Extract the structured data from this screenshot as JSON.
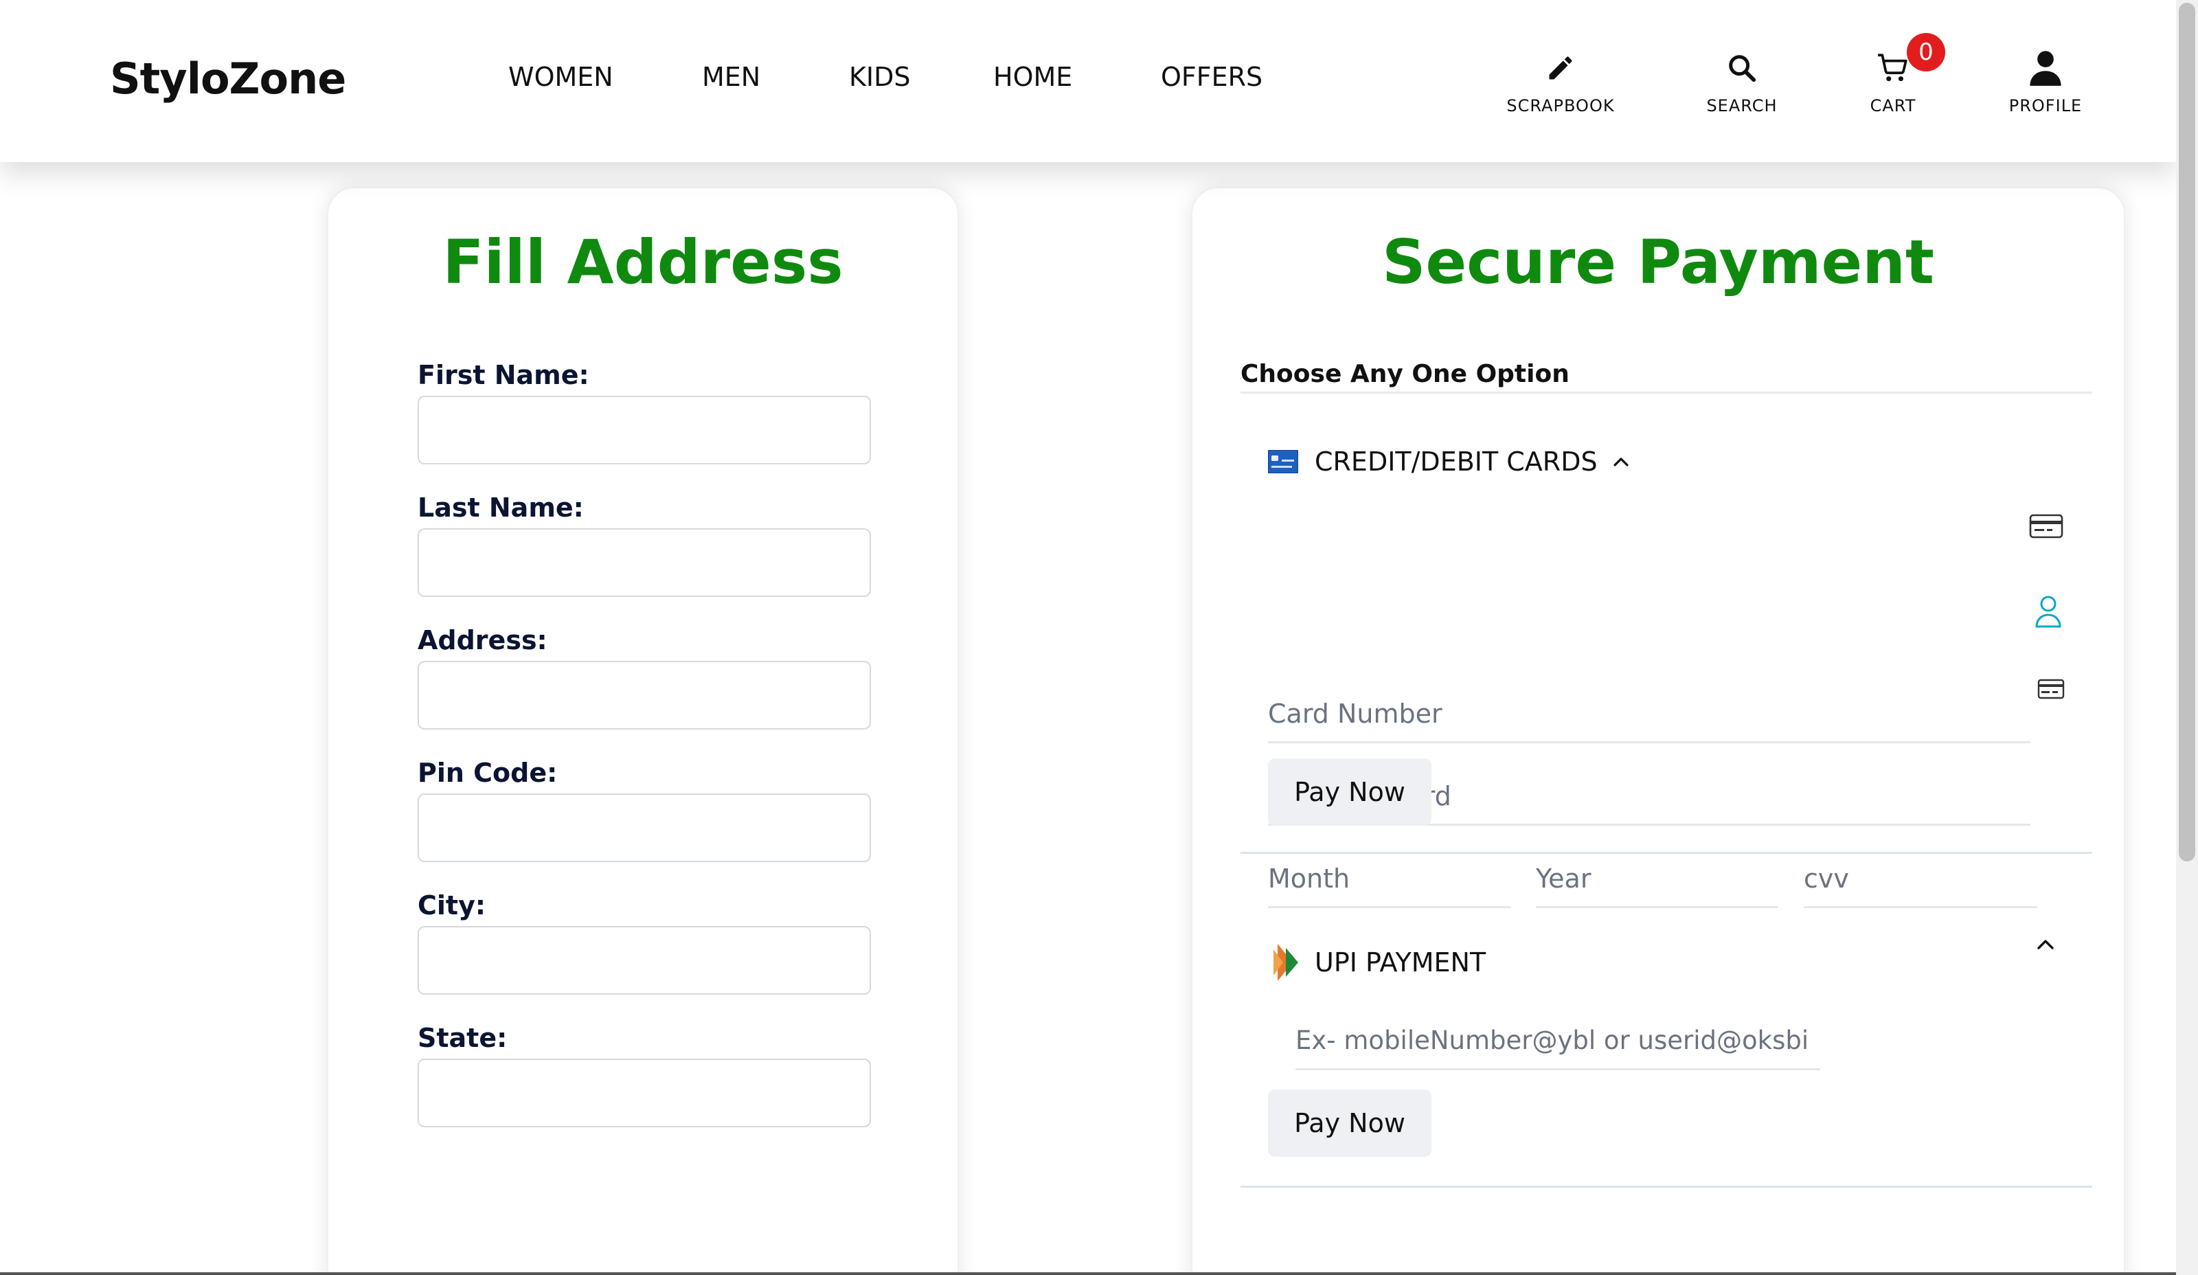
{
  "brand": {
    "logo": "StyloZone"
  },
  "nav": {
    "links": [
      "WOMEN",
      "MEN",
      "KIDS",
      "HOME",
      "OFFERS"
    ],
    "actions": {
      "scrapbook": "SCRAPBOOK",
      "search": "SEARCH",
      "cart": "CART",
      "profile": "PROFILE"
    },
    "cart_count": "0"
  },
  "address": {
    "title": "Fill Address",
    "fields": [
      {
        "label": "First Name:",
        "value": ""
      },
      {
        "label": "Last Name:",
        "value": ""
      },
      {
        "label": "Address:",
        "value": ""
      },
      {
        "label": "Pin Code:",
        "value": ""
      },
      {
        "label": "City:",
        "value": ""
      },
      {
        "label": "State:",
        "value": ""
      }
    ]
  },
  "payment": {
    "title": "Secure Payment",
    "choose_label": "Choose Any One Option",
    "card": {
      "heading": "CREDIT/DEBIT CARDS",
      "card_number_placeholder": "Card Number",
      "name_placeholder": "Name on card",
      "month_placeholder": "Month",
      "year_placeholder": "Year",
      "cvv_placeholder": "cvv",
      "pay_label": "Pay Now"
    },
    "upi": {
      "heading": "UPI PAYMENT",
      "placeholder": "Ex- mobileNumber@ybl or userid@oksbi",
      "pay_label": "Pay Now"
    }
  },
  "colors": {
    "title_green": "#0f8a0f",
    "badge_red": "#e11d1d",
    "user_icon_teal": "#0ea5c9"
  }
}
